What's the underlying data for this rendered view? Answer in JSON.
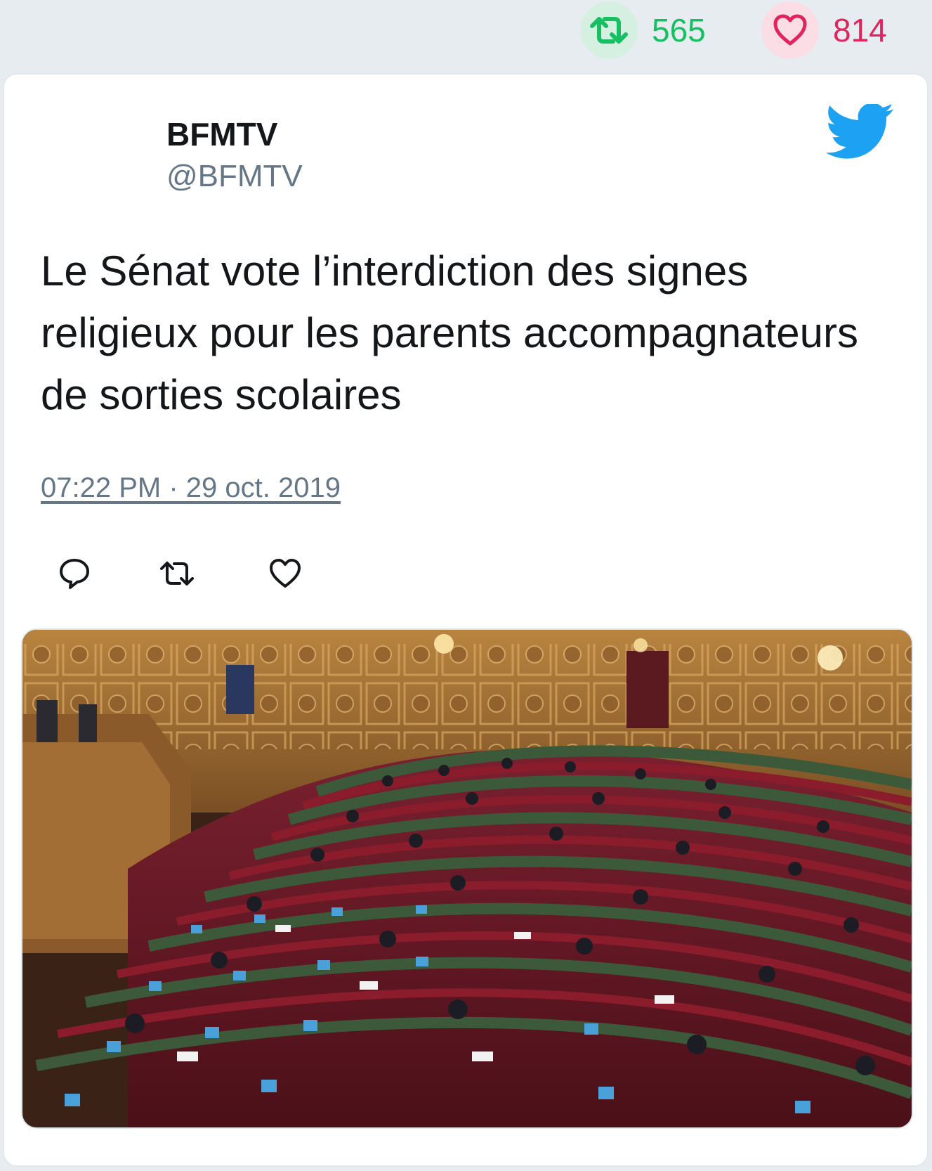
{
  "stats": {
    "retweets": "565",
    "likes": "814"
  },
  "tweet": {
    "display_name": "BFMTV",
    "handle": "@BFMTV",
    "text": "Le Sénat vote l’interdiction des signes religieux pour les parents accompagnateurs de sorties scolaires",
    "timestamp": "07:22 PM · 29 oct. 2019"
  },
  "icons": {
    "retweet": "retweet-icon",
    "like": "heart-icon",
    "reply": "reply-icon",
    "brand": "twitter-bird-icon"
  },
  "colors": {
    "retweet": "#17bf63",
    "like": "#e0245e",
    "twitter_blue": "#1da1f2",
    "secondary_text": "#657786",
    "background": "#e6ecf0"
  }
}
